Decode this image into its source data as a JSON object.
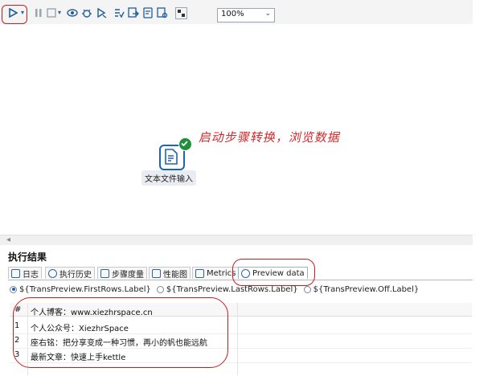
{
  "toolbar": {
    "zoom": "100%",
    "icons": [
      "run-icon",
      "pause-icon",
      "stop-icon",
      "preview-icon",
      "debug-icon",
      "replay-icon",
      "verify-icon",
      "impact-icon",
      "sql-icon",
      "explore-db-icon",
      "grid-toggle-icon"
    ]
  },
  "canvas": {
    "annotation": "启动步骤转换，浏览数据",
    "step_label": "文本文件输入"
  },
  "results": {
    "title": "执行结果",
    "tabs": [
      "日志",
      "执行历史",
      "步骤度量",
      "性能图",
      "Metrics",
      "Preview data"
    ],
    "radios": [
      "${TransPreview.FirstRows.Label}",
      "${TransPreview.LastRows.Label}",
      "${TransPreview.Off.Label}"
    ],
    "table": {
      "header_num": "#",
      "header_value": "个人博客：www.xiezhrspace.cn",
      "rows": [
        {
          "num": "1",
          "value": "个人公众号：XiezhrSpace"
        },
        {
          "num": "2",
          "value": "座右铭：把分享变成一种习惯，再小的帆也能远航"
        },
        {
          "num": "3",
          "value": "最新文章：快速上手kettle"
        }
      ]
    }
  },
  "colors": {
    "accent": "#1b65b5",
    "annotation": "#d12a2a",
    "success": "#1e8f3a"
  }
}
